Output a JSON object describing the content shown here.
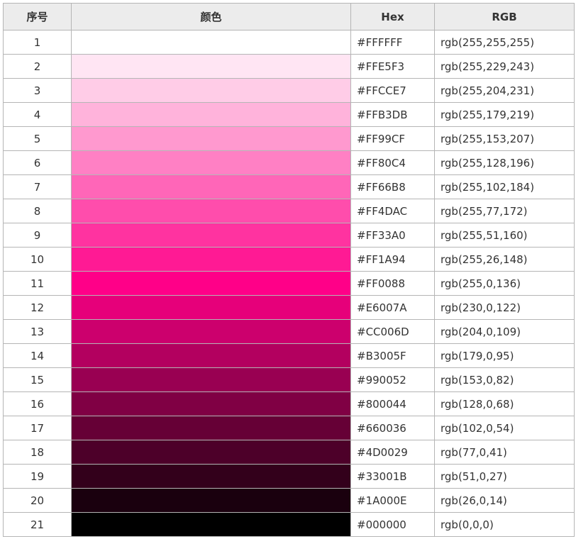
{
  "table": {
    "headers": {
      "index": "序号",
      "color": "颜色",
      "hex": "Hex",
      "rgb": "RGB"
    },
    "rows": [
      {
        "index": "1",
        "hex": "#FFFFFF",
        "rgb": "rgb(255,255,255)",
        "swatch": "#FFFFFF"
      },
      {
        "index": "2",
        "hex": "#FFE5F3",
        "rgb": "rgb(255,229,243)",
        "swatch": "#FFE5F3"
      },
      {
        "index": "3",
        "hex": "#FFCCE7",
        "rgb": "rgb(255,204,231)",
        "swatch": "#FFCCE7"
      },
      {
        "index": "4",
        "hex": "#FFB3DB",
        "rgb": "rgb(255,179,219)",
        "swatch": "#FFB3DB"
      },
      {
        "index": "5",
        "hex": "#FF99CF",
        "rgb": "rgb(255,153,207)",
        "swatch": "#FF99CF"
      },
      {
        "index": "6",
        "hex": "#FF80C4",
        "rgb": "rgb(255,128,196)",
        "swatch": "#FF80C4"
      },
      {
        "index": "7",
        "hex": "#FF66B8",
        "rgb": "rgb(255,102,184)",
        "swatch": "#FF66B8"
      },
      {
        "index": "8",
        "hex": "#FF4DAC",
        "rgb": "rgb(255,77,172)",
        "swatch": "#FF4DAC"
      },
      {
        "index": "9",
        "hex": "#FF33A0",
        "rgb": "rgb(255,51,160)",
        "swatch": "#FF33A0"
      },
      {
        "index": "10",
        "hex": "#FF1A94",
        "rgb": "rgb(255,26,148)",
        "swatch": "#FF1A94"
      },
      {
        "index": "11",
        "hex": "#FF0088",
        "rgb": "rgb(255,0,136)",
        "swatch": "#FF0088"
      },
      {
        "index": "12",
        "hex": "#E6007A",
        "rgb": "rgb(230,0,122)",
        "swatch": "#E6007A"
      },
      {
        "index": "13",
        "hex": "#CC006D",
        "rgb": "rgb(204,0,109)",
        "swatch": "#CC006D"
      },
      {
        "index": "14",
        "hex": "#B3005F",
        "rgb": "rgb(179,0,95)",
        "swatch": "#B3005F"
      },
      {
        "index": "15",
        "hex": "#990052",
        "rgb": "rgb(153,0,82)",
        "swatch": "#990052"
      },
      {
        "index": "16",
        "hex": "#800044",
        "rgb": "rgb(128,0,68)",
        "swatch": "#800044"
      },
      {
        "index": "17",
        "hex": "#660036",
        "rgb": "rgb(102,0,54)",
        "swatch": "#660036"
      },
      {
        "index": "18",
        "hex": "#4D0029",
        "rgb": "rgb(77,0,41)",
        "swatch": "#4D0029"
      },
      {
        "index": "19",
        "hex": "#33001B",
        "rgb": "rgb(51,0,27)",
        "swatch": "#33001B"
      },
      {
        "index": "20",
        "hex": "#1A000E",
        "rgb": "rgb(26,0,14)",
        "swatch": "#1A000E"
      },
      {
        "index": "21",
        "hex": "#000000",
        "rgb": "rgb(0,0,0)",
        "swatch": "#000000"
      }
    ]
  }
}
